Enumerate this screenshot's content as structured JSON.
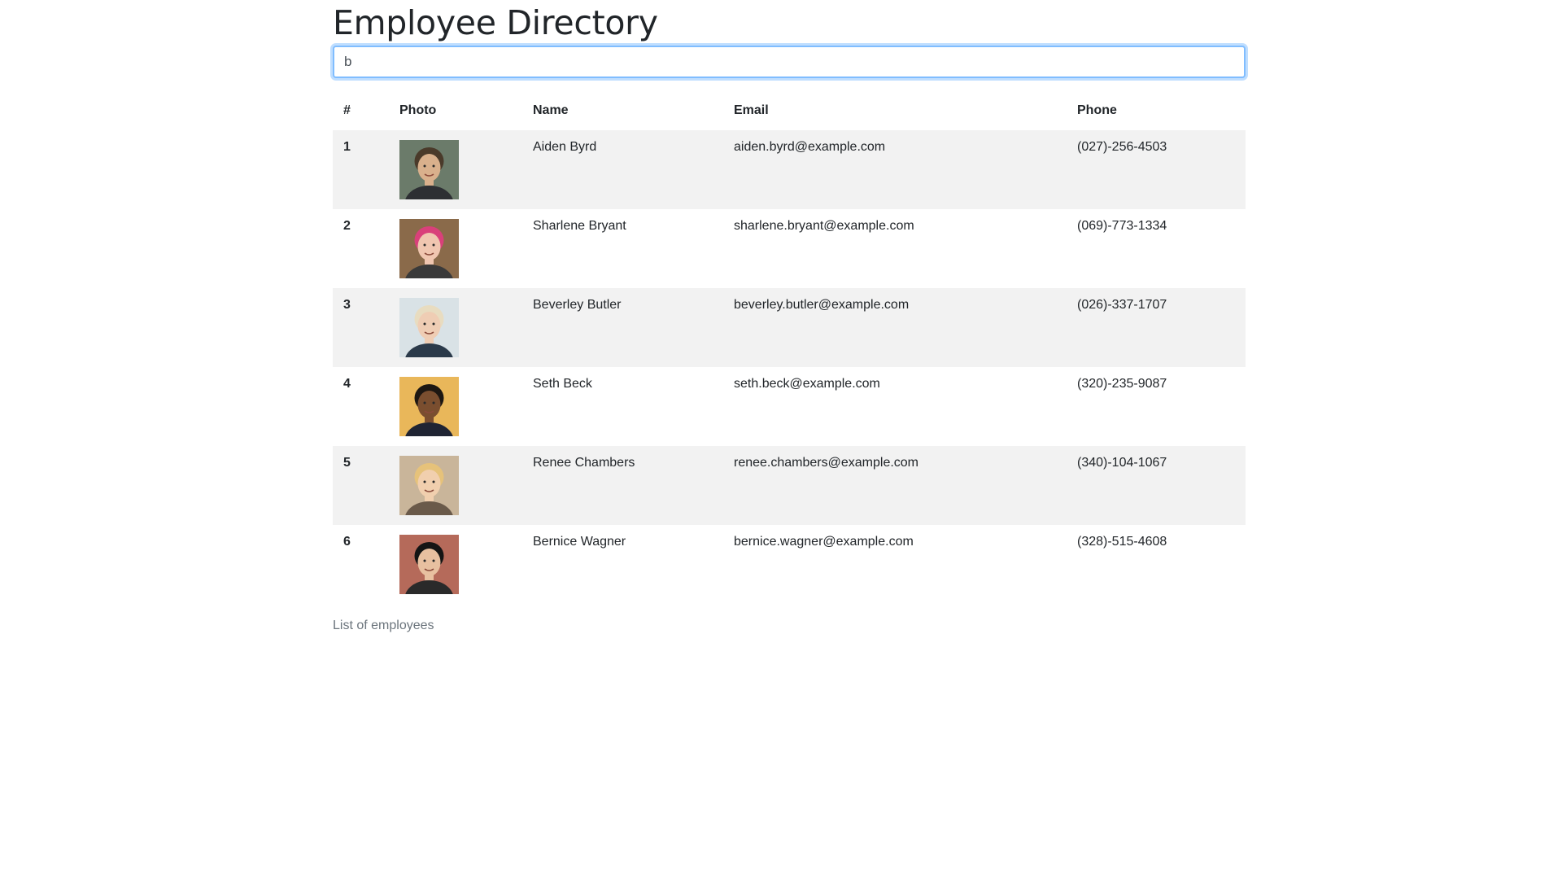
{
  "title": "Employee Directory",
  "search": {
    "value": "b"
  },
  "table": {
    "headers": [
      "#",
      "Photo",
      "Name",
      "Email",
      "Phone"
    ],
    "rows": [
      {
        "index": "1",
        "name": "Aiden Byrd",
        "email": "aiden.byrd@example.com",
        "phone": "(027)-256-4503",
        "photo": {
          "bg": "#6b7b6a",
          "skin": "#d9b08c",
          "hair": "#4a3a2a",
          "shirt": "#2d2f33"
        }
      },
      {
        "index": "2",
        "name": "Sharlene Bryant",
        "email": "sharlene.bryant@example.com",
        "phone": "(069)-773-1334",
        "photo": {
          "bg": "#8a6a4a",
          "skin": "#f0c6b0",
          "hair": "#d9407a",
          "shirt": "#3a3a3a"
        }
      },
      {
        "index": "3",
        "name": "Beverley Butler",
        "email": "beverley.butler@example.com",
        "phone": "(026)-337-1707",
        "photo": {
          "bg": "#d9e2e6",
          "skin": "#efcdb4",
          "hair": "#e8dcc0",
          "shirt": "#2b3a4a"
        }
      },
      {
        "index": "4",
        "name": "Seth Beck",
        "email": "seth.beck@example.com",
        "phone": "(320)-235-9087",
        "photo": {
          "bg": "#e9b75a",
          "skin": "#7a4e2f",
          "hair": "#1d1712",
          "shirt": "#1f2433"
        }
      },
      {
        "index": "5",
        "name": "Renee Chambers",
        "email": "renee.chambers@example.com",
        "phone": "(340)-104-1067",
        "photo": {
          "bg": "#c9b59a",
          "skin": "#f1cfae",
          "hair": "#e6c27a",
          "shirt": "#6a5a4a"
        }
      },
      {
        "index": "6",
        "name": "Bernice Wagner",
        "email": "bernice.wagner@example.com",
        "phone": "(328)-515-4608",
        "photo": {
          "bg": "#b56a5a",
          "skin": "#e8c0a0",
          "hair": "#141414",
          "shirt": "#2a2a2a"
        }
      }
    ]
  },
  "caption": "List of employees"
}
